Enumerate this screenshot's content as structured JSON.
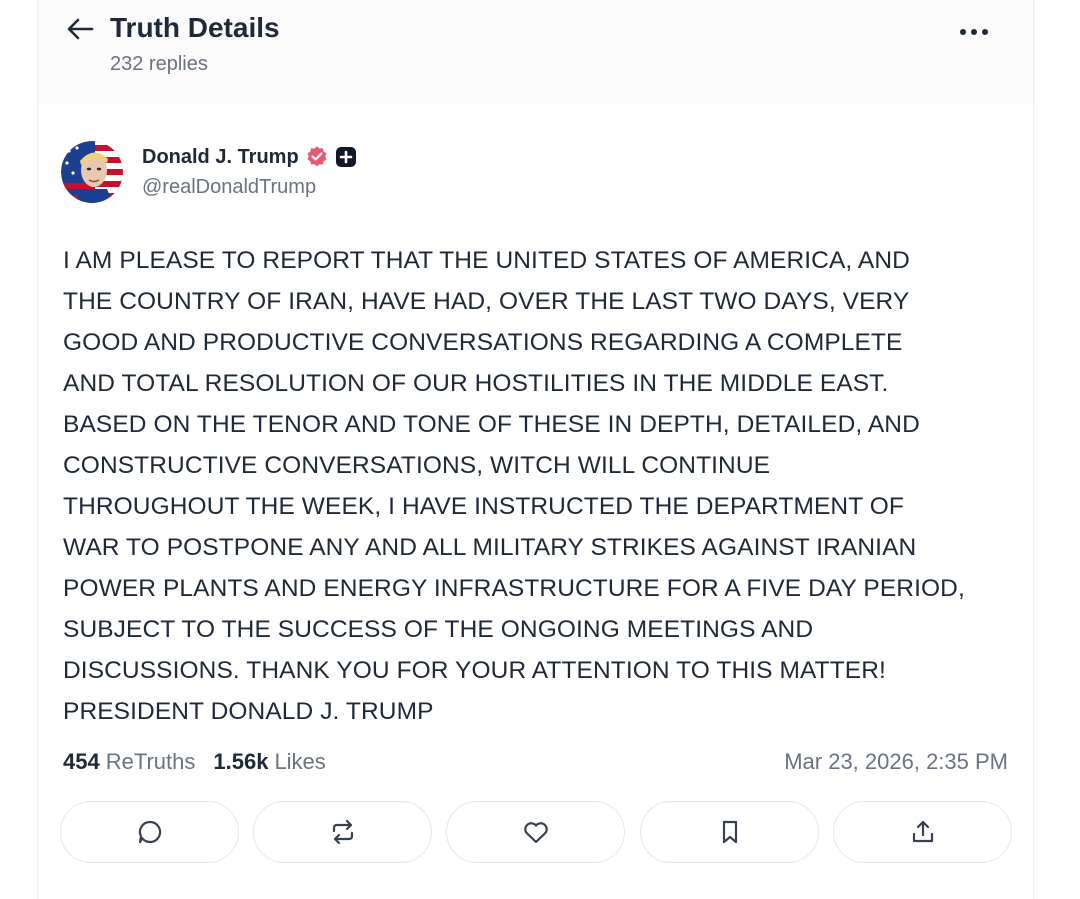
{
  "header": {
    "back_icon": "arrow-left-icon",
    "title": "Truth Details",
    "replies": "232 replies",
    "more_icon": "more-horizontal-icon"
  },
  "post": {
    "author": {
      "name": "Donald J. Trump",
      "handle": "@realDonaldTrump",
      "verified_icon": "verified-badge-icon",
      "verified_color": "#e25c75",
      "plus_icon": "plus-badge-icon"
    },
    "text_lines": [
      "I AM PLEASE TO REPORT THAT THE UNITED STATES OF AMERICA, AND",
      "THE COUNTRY OF IRAN, HAVE HAD, OVER THE LAST TWO DAYS, VERY",
      "GOOD AND PRODUCTIVE CONVERSATIONS REGARDING A COMPLETE",
      "AND TOTAL RESOLUTION OF OUR HOSTILITIES IN THE MIDDLE EAST.",
      "BASED ON THE TENOR AND TONE OF THESE IN DEPTH, DETAILED, AND",
      "CONSTRUCTIVE CONVERSATIONS, WITCH WILL CONTINUE",
      "THROUGHOUT THE WEEK, I HAVE INSTRUCTED THE DEPARTMENT OF",
      "WAR TO POSTPONE ANY AND ALL MILITARY STRIKES AGAINST IRANIAN",
      "POWER PLANTS AND ENERGY INFRASTRUCTURE FOR A FIVE DAY PERIOD,",
      "SUBJECT TO THE SUCCESS OF THE ONGOING MEETINGS AND",
      "DISCUSSIONS. THANK YOU FOR YOUR ATTENTION TO THIS MATTER!",
      "PRESIDENT DONALD J. TRUMP"
    ],
    "stats": {
      "retruths_count": "454",
      "retruths_label": "ReTruths",
      "likes_count": "1.56k",
      "likes_label": "Likes"
    },
    "timestamp": "Mar 23, 2026, 2:35 PM"
  },
  "actions": [
    {
      "icon": "reply-icon"
    },
    {
      "icon": "retruth-icon"
    },
    {
      "icon": "like-icon"
    },
    {
      "icon": "bookmark-icon"
    },
    {
      "icon": "share-icon"
    }
  ]
}
